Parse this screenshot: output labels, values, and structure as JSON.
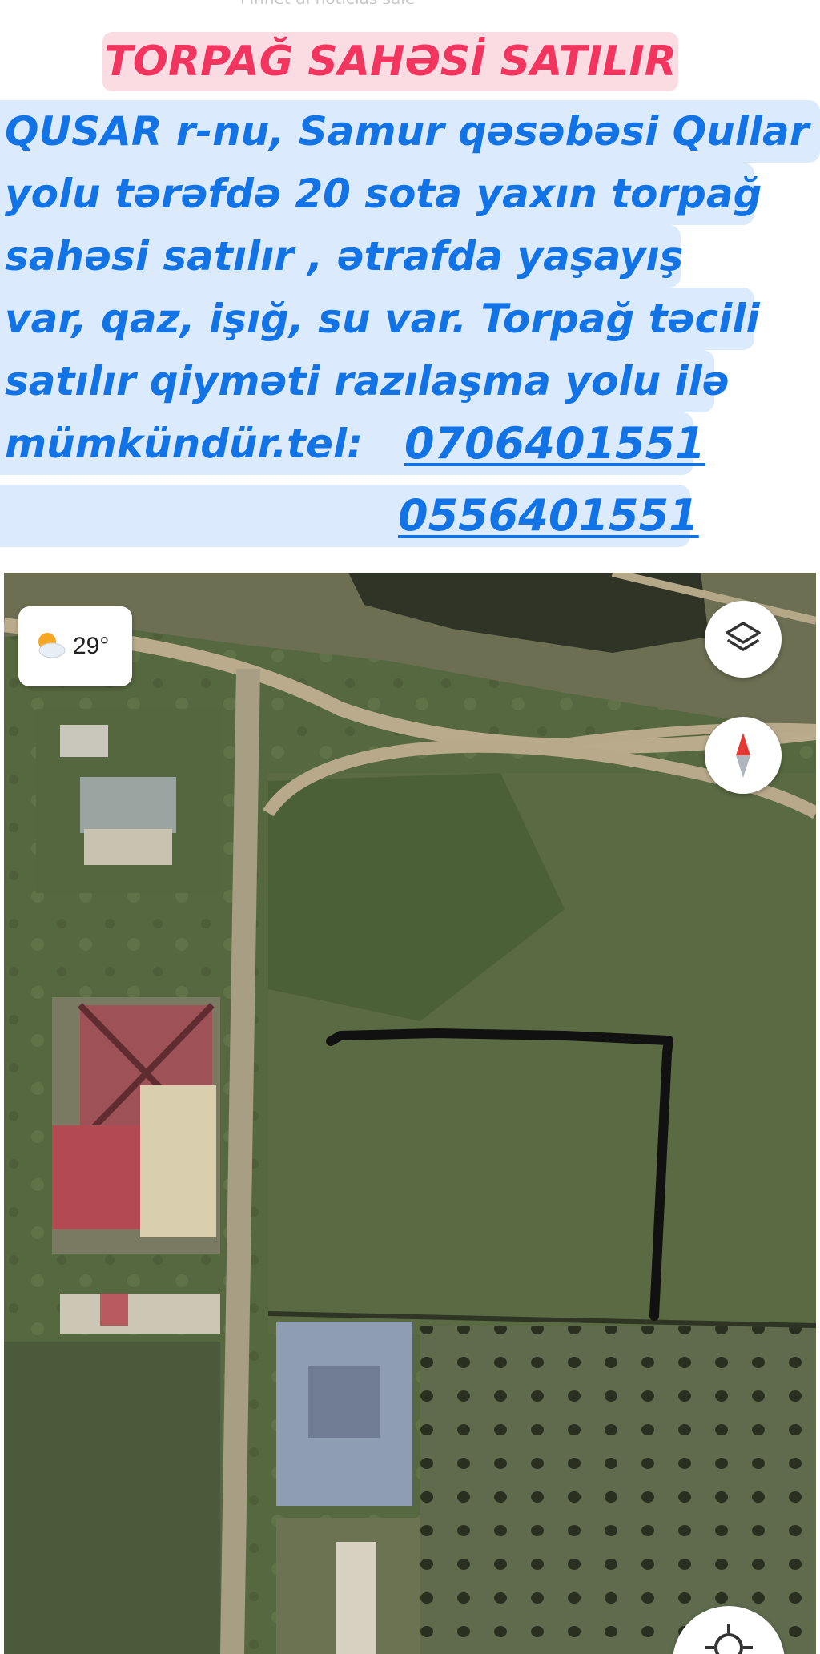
{
  "top_faint_text": "Pinnet di noticias sale",
  "ad": {
    "title": "TORPAĞ SAHƏSİ SATILIR",
    "description_lines": [
      "QUSAR r-nu, Samur qəsəbəsi Qullar",
      "yolu tərəfdə 20 sota yaxın torpağ",
      "sahəsi satılır , ətrafda yaşayış",
      "var, qaz, işığ, su var. Torpağ təcili",
      "satılır qiyməti razılaşma yolu ilə",
      "mümkündür.tel:"
    ],
    "phone_1": "0706401551",
    "phone_2": "0556401551"
  },
  "map": {
    "temperature": "29°",
    "weather_icon": "partly-cloudy-icon",
    "layers_icon": "layers-icon",
    "compass_icon": "compass-icon",
    "location_icon": "my-location-icon"
  },
  "colors": {
    "title_text": "#f2355f",
    "title_bg": "#fbdce3",
    "body_text": "#1273e6",
    "body_bg": "#dbeafc"
  }
}
